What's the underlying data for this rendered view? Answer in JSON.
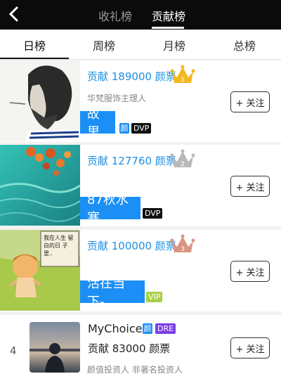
{
  "top_tabs": [
    "收礼榜",
    "贡献榜"
  ],
  "sub_tabs": [
    "日榜",
    "周榜",
    "月榜",
    "总榜"
  ],
  "entries": [
    {
      "contrib": "贡献 189000 颜票",
      "rank": "1",
      "subtitle": "华梵服饰主理人",
      "name": "故里",
      "badges": [
        "颜",
        "DVP"
      ],
      "follow": "+ 关注"
    },
    {
      "contrib": "贡献 127760 颜票",
      "rank": "2",
      "name": "87秋水寒",
      "badges": [
        "DVP"
      ],
      "follow": "+ 关注"
    },
    {
      "contrib": "贡献 100000 颜票",
      "rank": "3",
      "name": "活在当下-",
      "badges": [
        "VIP"
      ],
      "follow": "+ 关注"
    },
    {
      "rank": "4",
      "name": "MyChoice",
      "badges": [
        "颜",
        "DRE"
      ],
      "contrib": "贡献 83000 颜票",
      "subtitle": "颜值投资人 非著名投资人",
      "follow": "+ 关注"
    }
  ],
  "pic3_text": "我在人生 留白的日 子里..",
  "colors": {
    "gold": "#f5b820",
    "silver": "#b9b9b9",
    "bronze": "#d99582",
    "accent": "#1b8ff5"
  }
}
